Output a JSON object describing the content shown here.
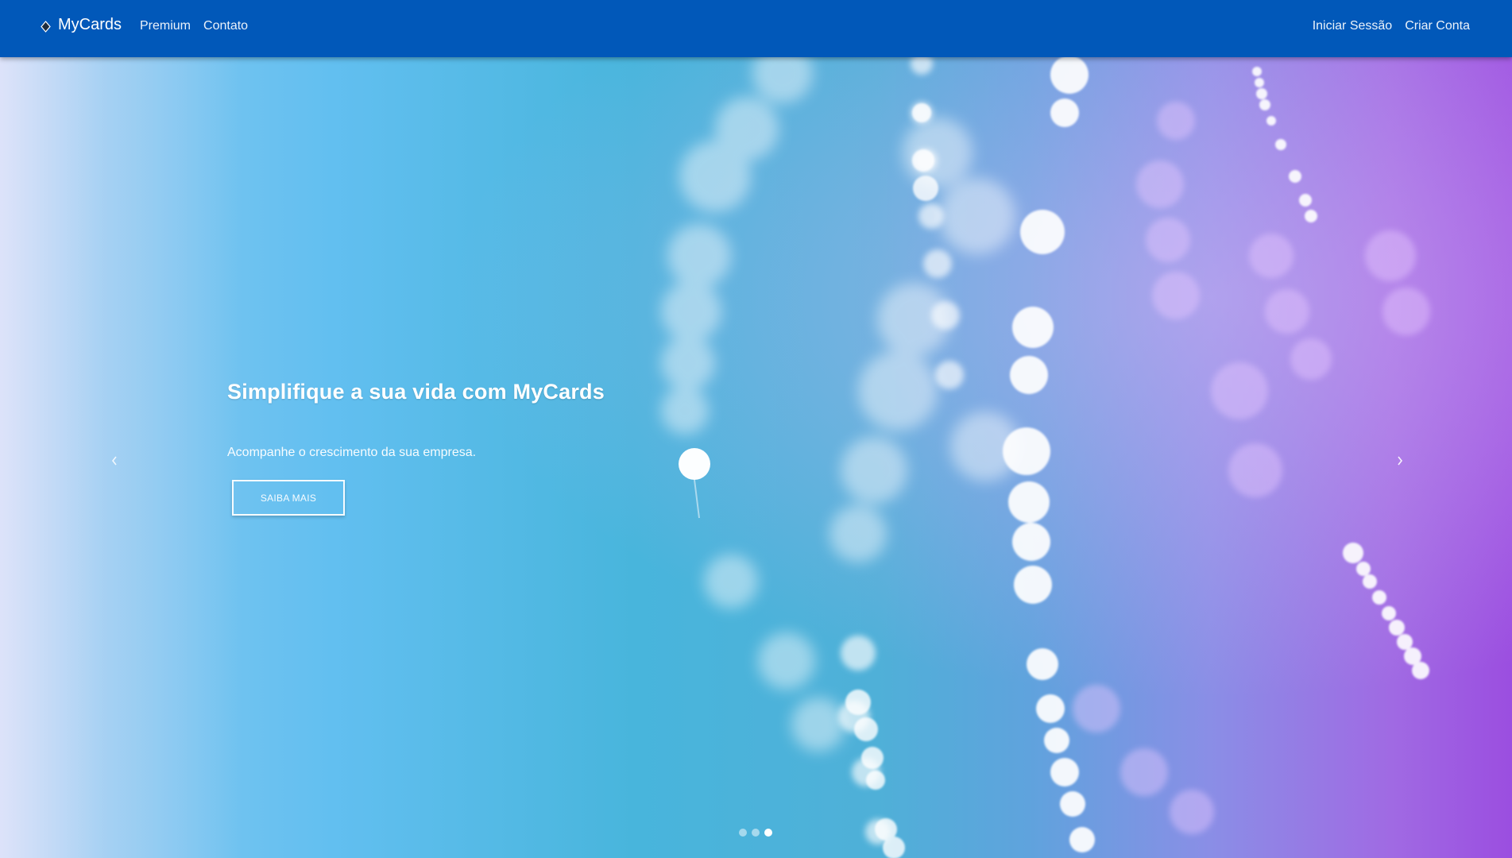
{
  "navbar": {
    "brand": "MyCards",
    "brand_icon": "diamond-logo-icon",
    "left_links": [
      {
        "label": "Premium"
      },
      {
        "label": "Contato"
      }
    ],
    "right_links": [
      {
        "label": "Iniciar Sessão"
      },
      {
        "label": "Criar Conta"
      }
    ],
    "color": "#0158b9"
  },
  "carousel": {
    "title": "Simplifique a sua vida com MyCards",
    "subtitle": "Acompanhe o crescimento da sua empresa.",
    "button_label": "SAIBA MAIS",
    "prev_icon": "chevron-left-icon",
    "next_icon": "chevron-right-icon",
    "slide_count": 3,
    "active_slide": 3
  }
}
